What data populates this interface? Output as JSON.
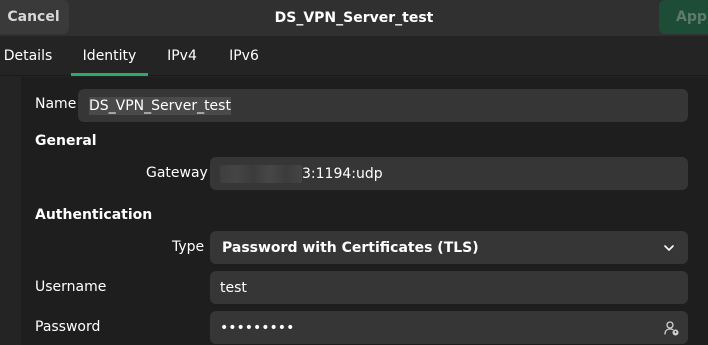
{
  "header": {
    "cancel_label": "Cancel",
    "title": "DS_VPN_Server_test",
    "apply_label": "Apply"
  },
  "tabs": [
    {
      "label": "Details",
      "active": false
    },
    {
      "label": "Identity",
      "active": true
    },
    {
      "label": "IPv4",
      "active": false
    },
    {
      "label": "IPv6",
      "active": false
    }
  ],
  "identity": {
    "name_label": "Name",
    "name_value": "DS_VPN_Server_test",
    "general_heading": "General",
    "gateway_label": "Gateway",
    "gateway_value_visible": "3:1194:udp",
    "authentication_heading": "Authentication",
    "type_label": "Type",
    "type_value": "Password with Certificates (TLS)",
    "username_label": "Username",
    "username_value": "test",
    "password_label": "Password",
    "password_value": "•••••••••"
  },
  "icons": {
    "chevron": "chevron-down-icon",
    "password_options": "user-password-icon"
  },
  "colors": {
    "accent_tab_underline": "#2fa86c",
    "apply_button_bg": "#1e4d37"
  }
}
